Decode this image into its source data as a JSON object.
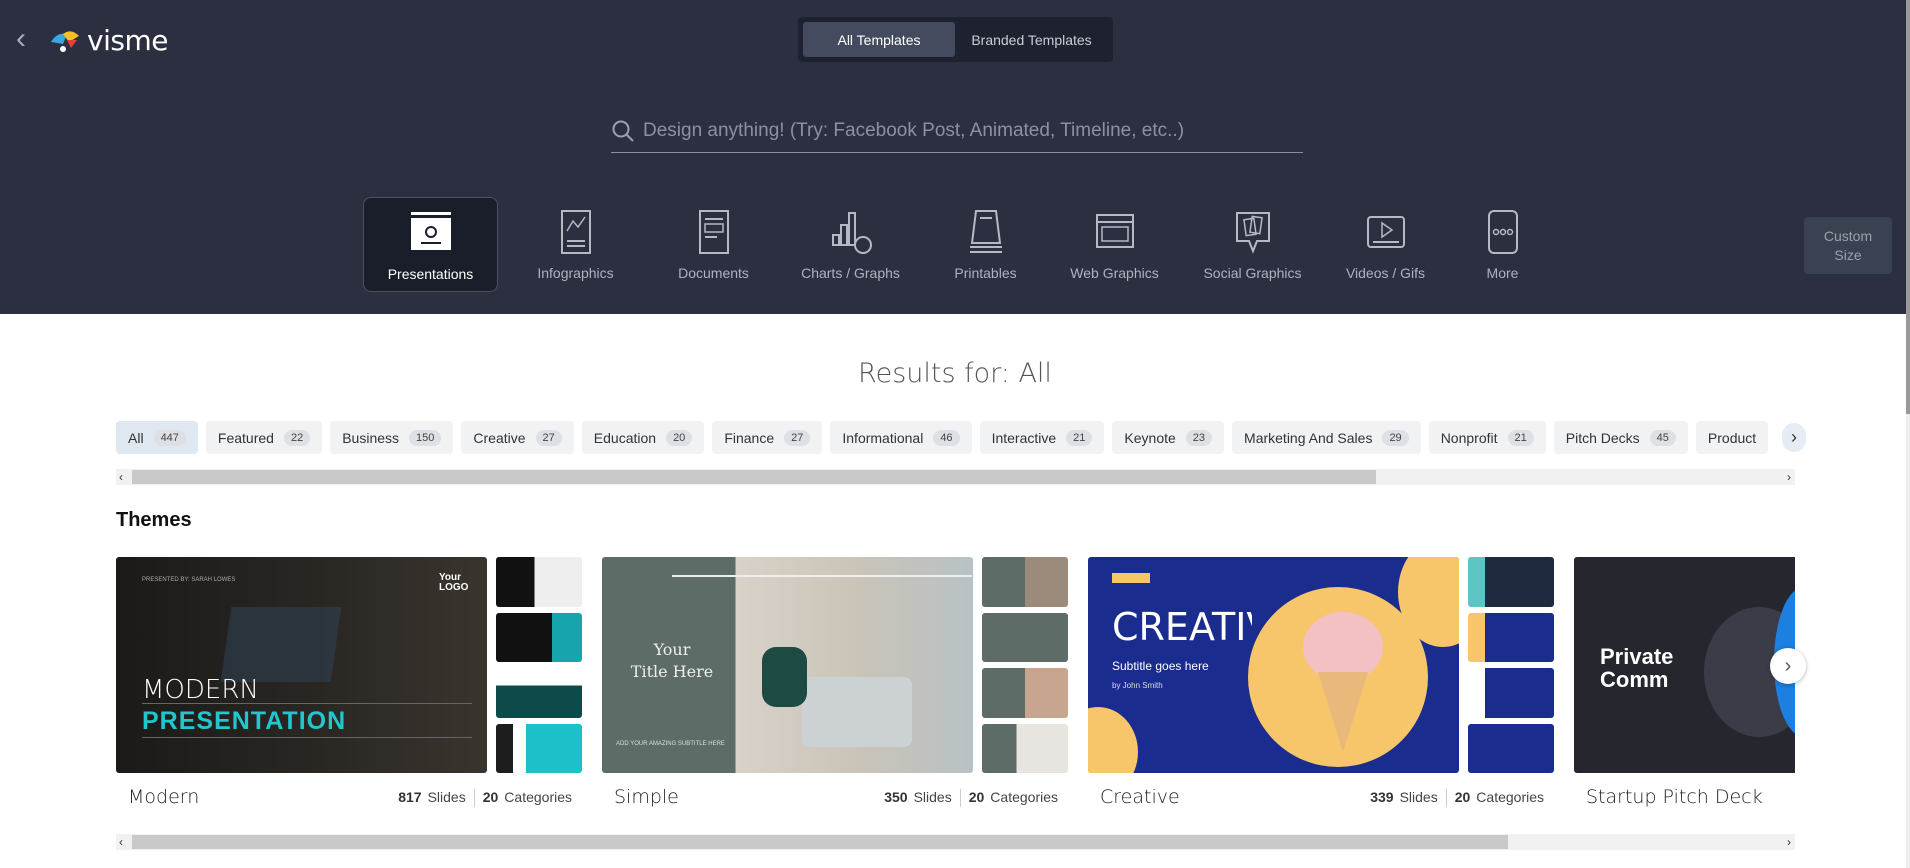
{
  "header": {
    "brand": "visme",
    "toggle": [
      {
        "label": "All Templates",
        "active": true
      },
      {
        "label": "Branded Templates",
        "active": false
      }
    ],
    "search_placeholder": "Design anything! (Try: Facebook Post, Animated, Timeline, etc..)",
    "categories": [
      {
        "label": "Presentations",
        "icon": "presentation-icon",
        "active": true
      },
      {
        "label": "Infographics",
        "icon": "infographic-icon"
      },
      {
        "label": "Documents",
        "icon": "document-icon"
      },
      {
        "label": "Charts / Graphs",
        "icon": "chart-icon"
      },
      {
        "label": "Printables",
        "icon": "printable-icon"
      },
      {
        "label": "Web Graphics",
        "icon": "web-graphic-icon"
      },
      {
        "label": "Social Graphics",
        "icon": "social-graphic-icon"
      },
      {
        "label": "Videos / Gifs",
        "icon": "video-icon"
      },
      {
        "label": "More",
        "icon": "more-icon"
      }
    ],
    "custom_size": "Custom Size"
  },
  "results_title": "Results for: All",
  "chips": [
    {
      "label": "All",
      "count": "447",
      "active": true
    },
    {
      "label": "Featured",
      "count": "22"
    },
    {
      "label": "Business",
      "count": "150"
    },
    {
      "label": "Creative",
      "count": "27"
    },
    {
      "label": "Education",
      "count": "20"
    },
    {
      "label": "Finance",
      "count": "27"
    },
    {
      "label": "Informational",
      "count": "46"
    },
    {
      "label": "Interactive",
      "count": "21"
    },
    {
      "label": "Keynote",
      "count": "23"
    },
    {
      "label": "Marketing And Sales",
      "count": "29"
    },
    {
      "label": "Nonprofit",
      "count": "21"
    },
    {
      "label": "Pitch Decks",
      "count": "45"
    },
    {
      "label": "Product",
      "count": ""
    }
  ],
  "themes_title": "Themes",
  "themes": [
    {
      "name": "Modern",
      "slides": "817",
      "slides_label": "Slides",
      "categories": "20",
      "categories_label": "Categories",
      "preview_line1": "MODERN",
      "preview_line2": "PRESENTATION",
      "preview_small": "PRESENTED BY: SARAH LOWES",
      "preview_logo": "Your LOGO"
    },
    {
      "name": "Simple",
      "slides": "350",
      "slides_label": "Slides",
      "categories": "20",
      "categories_label": "Categories",
      "preview_line1": "Your",
      "preview_line2": "Title Here",
      "preview_small": "ADD YOUR AMAZING SUBTITLE HERE"
    },
    {
      "name": "Creative",
      "slides": "339",
      "slides_label": "Slides",
      "categories": "20",
      "categories_label": "Categories",
      "preview_line1": "CREATIVE",
      "preview_line2": "Subtitle goes here",
      "preview_small": "by John Smith"
    },
    {
      "name": "Startup Pitch Deck",
      "preview_line1": "Private",
      "preview_line2": "Comm"
    }
  ]
}
